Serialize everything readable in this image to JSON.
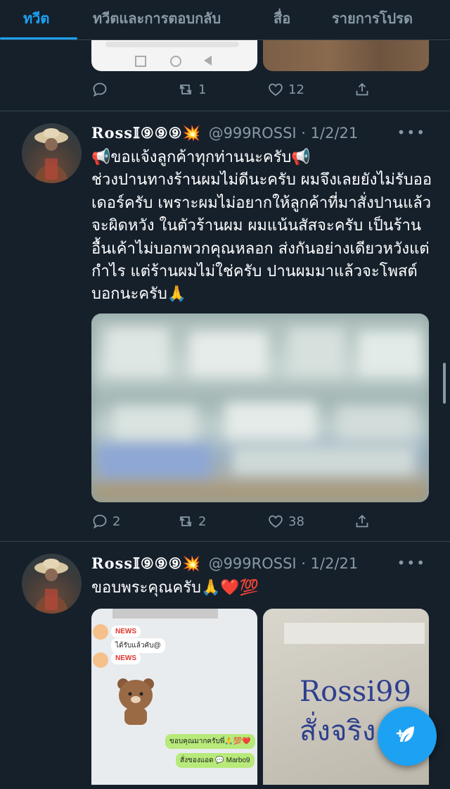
{
  "tabs": [
    {
      "label": "ทวีต",
      "active": true
    },
    {
      "label": "ทวีตและการตอบกลับ",
      "active": false
    },
    {
      "label": "สื่อ",
      "active": false
    },
    {
      "label": "รายการโปรด",
      "active": false
    }
  ],
  "prev_tweet": {
    "actions": {
      "reply_count": "",
      "retweet_count": "1",
      "like_count": "12"
    }
  },
  "tweet1": {
    "display_name": "Ross𝕀⑨⑨⑨💥",
    "handle": "@999ROSSI",
    "date": "1/2/21",
    "text": "📢ขอแจ้งลูกค้าทุกท่านนะครับ📢\nช่วงปานทางร้านผมไม่ดีนะครับ ผมจึงเลยยังไม่รับออเดอร์ครับ เพราะผมไม่อยากให้ลูกค้าที่มาสั่งปานแล้วจะผิดหวัง ในตัวร้านผม ผมแน้นสัสจะครับ เป็นร้านอื้นเค้าไม่บอกพวกคุณหลอก ส่งกันอย่างเดียวหวังแต่กำไร แต่ร้านผมไม่ใช่ครับ ปานผมมาแล้วจะโพสต์บอกนะครับ🙏",
    "actions": {
      "reply_count": "2",
      "retweet_count": "2",
      "like_count": "38"
    }
  },
  "tweet2": {
    "display_name": "Ross𝕀⑨⑨⑨💥",
    "handle": "@999ROSSI",
    "date": "1/2/21",
    "text": "ขอบพระคุณครับ🙏❤️💯",
    "chat": {
      "news_label": "NEWS",
      "msg1": "ได้รับแล้วคับ@",
      "msg2": "ขอบคุณมากครับพี่🙏💯❤️",
      "msg3": "สั่งของแอด 💬 Marbo9"
    },
    "handwriting": "Rossi99\nสั่งจริง"
  },
  "colors": {
    "accent": "#1da1f2",
    "background": "#15202b",
    "muted": "#8899a6",
    "divider": "#38444d"
  }
}
